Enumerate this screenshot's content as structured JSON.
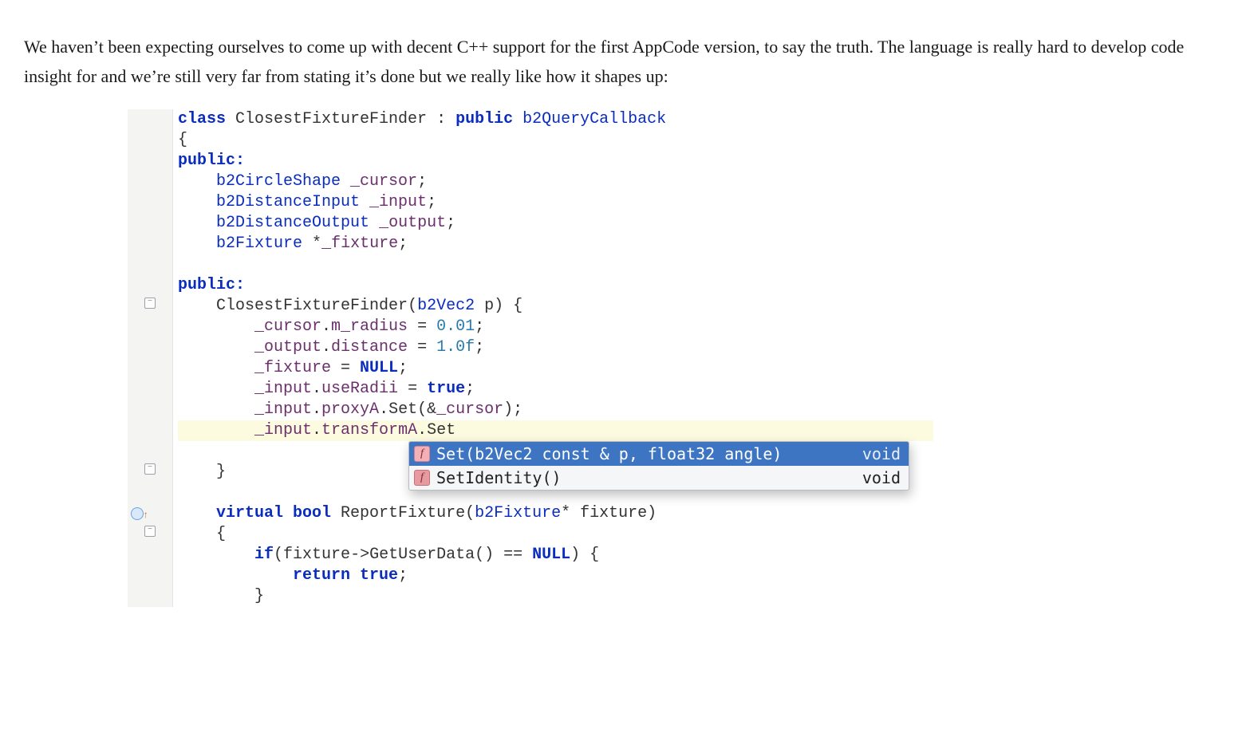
{
  "intro": "We haven’t been expecting ourselves to come up with decent C++ support for the first AppCode version, to say the truth. The language is really hard to develop code insight for and we’re still very far from stating it’s done but we really like how it shapes up:",
  "code": {
    "lines": [
      {
        "indent": 0,
        "tokens": [
          {
            "t": "class ",
            "c": "kw"
          },
          {
            "t": "ClosestFixtureFinder",
            "c": "id"
          },
          {
            "t": " : ",
            "c": "op"
          },
          {
            "t": "public ",
            "c": "kw"
          },
          {
            "t": "b2QueryCallback",
            "c": "type"
          }
        ]
      },
      {
        "indent": 0,
        "tokens": [
          {
            "t": "{",
            "c": "op"
          }
        ]
      },
      {
        "indent": 0,
        "tokens": [
          {
            "t": "public:",
            "c": "kw"
          }
        ]
      },
      {
        "indent": 1,
        "tokens": [
          {
            "t": "b2CircleShape ",
            "c": "type"
          },
          {
            "t": "_cursor",
            "c": "fld"
          },
          {
            "t": ";",
            "c": "op"
          }
        ]
      },
      {
        "indent": 1,
        "tokens": [
          {
            "t": "b2DistanceInput ",
            "c": "type"
          },
          {
            "t": "_input",
            "c": "fld"
          },
          {
            "t": ";",
            "c": "op"
          }
        ]
      },
      {
        "indent": 1,
        "tokens": [
          {
            "t": "b2DistanceOutput ",
            "c": "type"
          },
          {
            "t": "_output",
            "c": "fld"
          },
          {
            "t": ";",
            "c": "op"
          }
        ]
      },
      {
        "indent": 1,
        "tokens": [
          {
            "t": "b2Fixture ",
            "c": "type"
          },
          {
            "t": "*",
            "c": "op"
          },
          {
            "t": "_fixture",
            "c": "fld"
          },
          {
            "t": ";",
            "c": "op"
          }
        ]
      },
      {
        "indent": 0,
        "tokens": []
      },
      {
        "indent": 0,
        "tokens": [
          {
            "t": "public:",
            "c": "kw"
          }
        ]
      },
      {
        "indent": 1,
        "tokens": [
          {
            "t": "ClosestFixtureFinder",
            "c": "id"
          },
          {
            "t": "(",
            "c": "op"
          },
          {
            "t": "b2Vec2 ",
            "c": "type"
          },
          {
            "t": "p",
            "c": "id"
          },
          {
            "t": ") {",
            "c": "op"
          }
        ],
        "foldStart": true
      },
      {
        "indent": 2,
        "tokens": [
          {
            "t": "_cursor",
            "c": "fld"
          },
          {
            "t": ".",
            "c": "op"
          },
          {
            "t": "m_radius",
            "c": "fld"
          },
          {
            "t": " = ",
            "c": "op"
          },
          {
            "t": "0.01",
            "c": "num"
          },
          {
            "t": ";",
            "c": "op"
          }
        ]
      },
      {
        "indent": 2,
        "tokens": [
          {
            "t": "_output",
            "c": "fld"
          },
          {
            "t": ".",
            "c": "op"
          },
          {
            "t": "distance",
            "c": "fld"
          },
          {
            "t": " = ",
            "c": "op"
          },
          {
            "t": "1.0f",
            "c": "num"
          },
          {
            "t": ";",
            "c": "op"
          }
        ]
      },
      {
        "indent": 2,
        "tokens": [
          {
            "t": "_fixture",
            "c": "fld"
          },
          {
            "t": " = ",
            "c": "op"
          },
          {
            "t": "NULL",
            "c": "kw"
          },
          {
            "t": ";",
            "c": "op"
          }
        ]
      },
      {
        "indent": 2,
        "tokens": [
          {
            "t": "_input",
            "c": "fld"
          },
          {
            "t": ".",
            "c": "op"
          },
          {
            "t": "useRadii",
            "c": "fld"
          },
          {
            "t": " = ",
            "c": "op"
          },
          {
            "t": "true",
            "c": "kw"
          },
          {
            "t": ";",
            "c": "op"
          }
        ]
      },
      {
        "indent": 2,
        "tokens": [
          {
            "t": "_input",
            "c": "fld"
          },
          {
            "t": ".",
            "c": "op"
          },
          {
            "t": "proxyA",
            "c": "fld"
          },
          {
            "t": ".",
            "c": "op"
          },
          {
            "t": "Set",
            "c": "id"
          },
          {
            "t": "(&",
            "c": "op"
          },
          {
            "t": "_cursor",
            "c": "fld"
          },
          {
            "t": ");",
            "c": "op"
          }
        ]
      },
      {
        "indent": 2,
        "tokens": [
          {
            "t": "_input",
            "c": "fld"
          },
          {
            "t": ".",
            "c": "op"
          },
          {
            "t": "transformA",
            "c": "fld"
          },
          {
            "t": ".",
            "c": "op"
          },
          {
            "t": "Set",
            "c": "id"
          }
        ],
        "highlight": true
      },
      {
        "indent": 0,
        "tokens": []
      },
      {
        "indent": 1,
        "tokens": [
          {
            "t": "}",
            "c": "op"
          }
        ],
        "foldEnd": true
      },
      {
        "indent": 0,
        "tokens": []
      },
      {
        "indent": 1,
        "tokens": [
          {
            "t": "virtual ",
            "c": "kw"
          },
          {
            "t": "bool ",
            "c": "kw"
          },
          {
            "t": "ReportFixture",
            "c": "id"
          },
          {
            "t": "(",
            "c": "op"
          },
          {
            "t": "b2Fixture",
            "c": "type"
          },
          {
            "t": "* ",
            "c": "op"
          },
          {
            "t": "fixture",
            "c": "id"
          },
          {
            "t": ")",
            "c": "op"
          }
        ],
        "override": true
      },
      {
        "indent": 1,
        "tokens": [
          {
            "t": "{",
            "c": "op"
          }
        ],
        "foldStart": true
      },
      {
        "indent": 2,
        "tokens": [
          {
            "t": "if",
            "c": "kw"
          },
          {
            "t": "(",
            "c": "op"
          },
          {
            "t": "fixture",
            "c": "id"
          },
          {
            "t": "->",
            "c": "op"
          },
          {
            "t": "GetUserData",
            "c": "id"
          },
          {
            "t": "() == ",
            "c": "op"
          },
          {
            "t": "NULL",
            "c": "kw"
          },
          {
            "t": ") {",
            "c": "op"
          }
        ]
      },
      {
        "indent": 3,
        "tokens": [
          {
            "t": "return ",
            "c": "kw"
          },
          {
            "t": "true",
            "c": "kw"
          },
          {
            "t": ";",
            "c": "op"
          }
        ]
      },
      {
        "indent": 2,
        "tokens": [
          {
            "t": "}",
            "c": "op"
          }
        ]
      }
    ]
  },
  "completion": {
    "items": [
      {
        "icon": "f",
        "signature": "Set(b2Vec2 const & p, float32 angle)",
        "return": "void",
        "selected": true
      },
      {
        "icon": "f",
        "signature": "SetIdentity()",
        "return": "void",
        "selected": false
      }
    ]
  }
}
